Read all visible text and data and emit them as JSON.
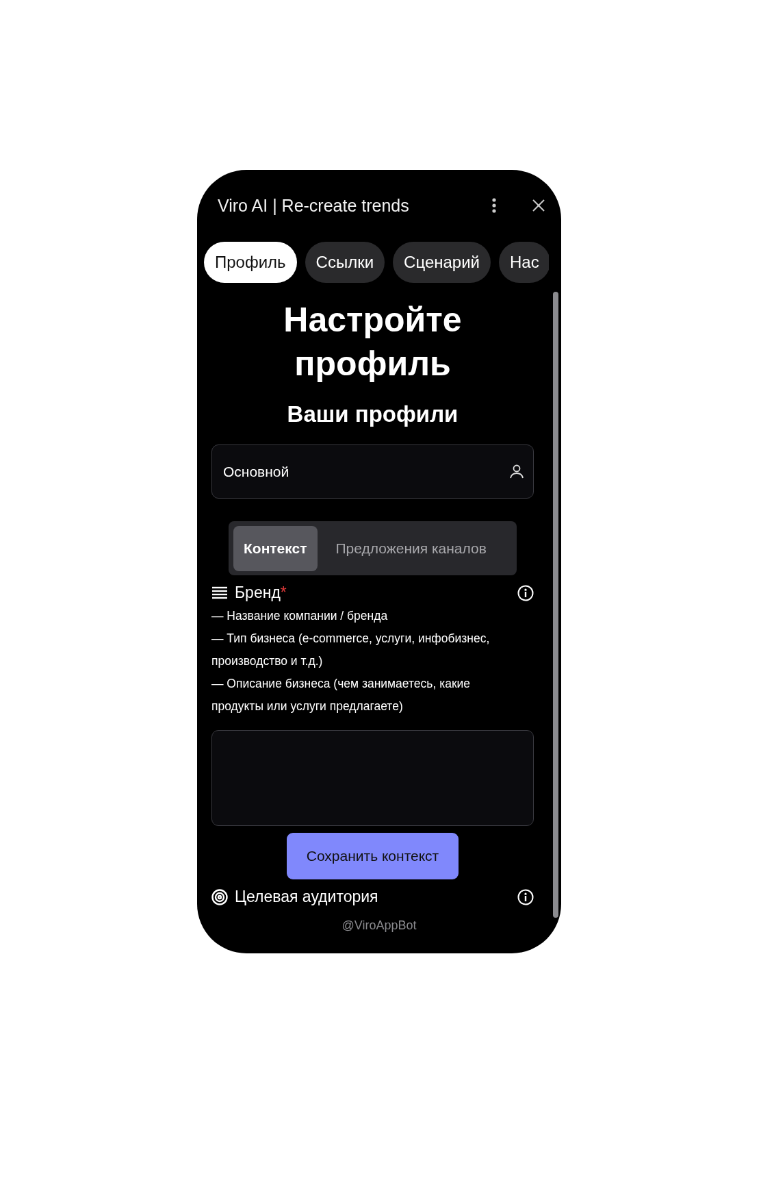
{
  "window": {
    "title": "Viro AI | Re-create trends"
  },
  "tabs": [
    {
      "label": "Профиль",
      "selected": true
    },
    {
      "label": "Ссылки",
      "selected": false
    },
    {
      "label": "Сценарий",
      "selected": false
    },
    {
      "label": "Нас",
      "selected": false
    }
  ],
  "heading": "Настройте профиль",
  "subheading": "Ваши профили",
  "profile_field": {
    "value": "Основной"
  },
  "segments": [
    {
      "label": "Контекст",
      "selected": true
    },
    {
      "label": "Предложения каналов",
      "selected": false
    }
  ],
  "sections": [
    {
      "kind": "list",
      "title": "Бренд",
      "required_mark": "*",
      "description": [
        "— Название компании / бренда",
        "— Тип бизнеса (e-commerce, услуги, инфобизнес, производство и т.д.)",
        "— Описание бизнеса (чем занимаетесь, какие продукты или услуги предлагаете)"
      ]
    },
    {
      "kind": "target",
      "title": "Целевая аудитория"
    }
  ],
  "save_button": "Сохранить контекст",
  "footer": "@ViroAppBot"
}
